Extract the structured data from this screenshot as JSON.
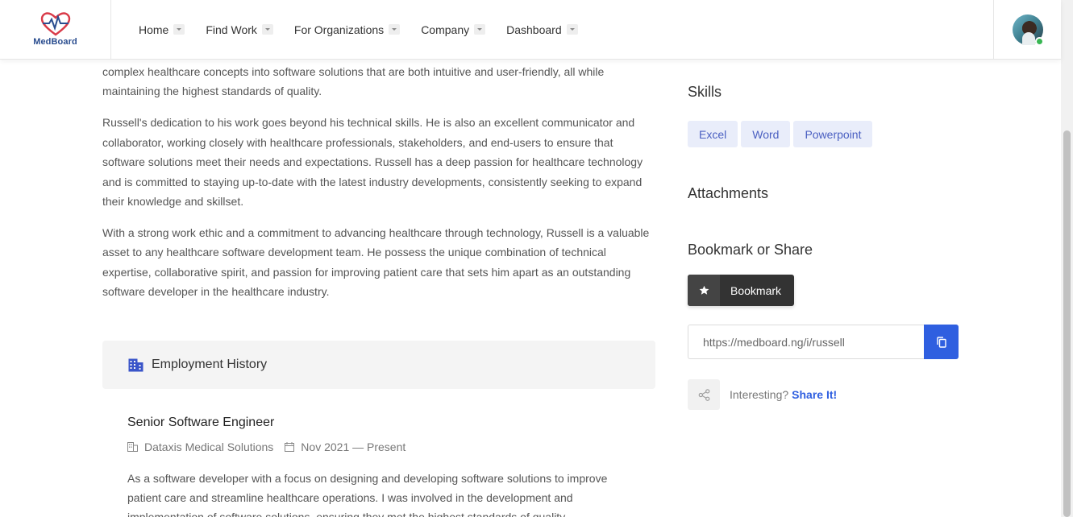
{
  "brand": {
    "name": "MedBoard"
  },
  "nav": {
    "items": [
      {
        "label": "Home"
      },
      {
        "label": "Find Work"
      },
      {
        "label": "For Organizations"
      },
      {
        "label": "Company"
      },
      {
        "label": "Dashboard"
      }
    ]
  },
  "about": {
    "paragraphs": [
      "complex healthcare concepts into software solutions that are both intuitive and user-friendly, all while maintaining the highest standards of quality.",
      "Russell's dedication to his work goes beyond his technical skills. He is also an excellent communicator and collaborator, working closely with healthcare professionals, stakeholders, and end-users to ensure that software solutions meet their needs and expectations. Russell has a deep passion for healthcare technology and is committed to staying up-to-date with the latest industry developments, consistently seeking to expand their knowledge and skillset.",
      "With a strong work ethic and a commitment to advancing healthcare through technology, Russell is a valuable asset to any healthcare software development team. He possess the unique combination of technical expertise, collaborative spirit, and passion for improving patient care that sets him apart as an outstanding software developer in the healthcare industry."
    ]
  },
  "employment": {
    "section_title": "Employment History",
    "jobs": [
      {
        "title": "Senior Software Engineer",
        "company": "Dataxis Medical Solutions",
        "period": "Nov 2021 — Present",
        "description": "As a software developer with a focus on designing and developing software solutions to improve patient care and streamline healthcare operations. I was involved in the development and implementation of software solutions, ensuring they met the highest standards of quality"
      }
    ]
  },
  "sidebar": {
    "skills_title": "Skills",
    "skills": [
      "Excel",
      "Word",
      "Powerpoint"
    ],
    "attachments_title": "Attachments",
    "bookmark_title": "Bookmark or Share",
    "bookmark_label": "Bookmark",
    "share_url": "https://medboard.ng/i/russell",
    "interesting_label": "Interesting?",
    "share_link_label": "Share It!"
  },
  "colors": {
    "accent": "#2f5fe0",
    "tag_bg": "#e9edfa",
    "tag_text": "#4a5fc1",
    "online": "#38b653"
  }
}
